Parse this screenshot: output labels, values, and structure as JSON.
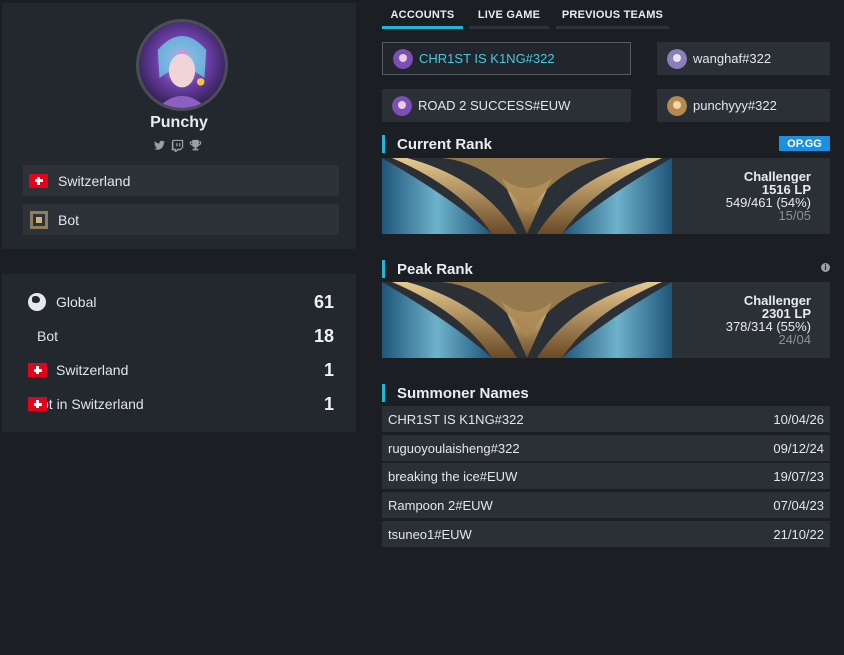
{
  "profile": {
    "name": "Punchy",
    "tags": [
      {
        "label": "Switzerland",
        "icon": "swiss-flag-icon"
      },
      {
        "label": "Bot",
        "icon": "bot-role-icon"
      }
    ],
    "social_icons": [
      "twitter-icon",
      "twitch-icon",
      "trophy-icon"
    ]
  },
  "ranking": [
    {
      "label": "Global",
      "value": "61",
      "icon": "globe-icon"
    },
    {
      "label": "Bot",
      "value": "18",
      "icon": ""
    },
    {
      "label": "Switzerland",
      "value": "1",
      "icon": "swiss-flag-icon"
    },
    {
      "label": "ot in Switzerland",
      "value": "1",
      "icon": "swiss-flag-icon"
    }
  ],
  "tabs": [
    {
      "label": "ACCOUNTS",
      "active": true
    },
    {
      "label": "LIVE GAME",
      "active": false
    },
    {
      "label": "PREVIOUS TEAMS",
      "active": false
    }
  ],
  "accounts": [
    {
      "name": "CHR1ST IS K1NG#322",
      "selected": true
    },
    {
      "name": "wanghaf#322",
      "selected": false
    },
    {
      "name": "ROAD 2 SUCCESS#EUW",
      "selected": false
    },
    {
      "name": "punchyyy#322",
      "selected": false
    }
  ],
  "current_rank": {
    "title": "Current Rank",
    "badge": "OP.GG",
    "tier": "Challenger",
    "lp": "1516 LP",
    "record": "549/461 (54%)",
    "date": "15/05"
  },
  "peak_rank": {
    "title": "Peak Rank",
    "tier": "Challenger",
    "lp": "2301 LP",
    "record": "378/314 (55%)",
    "date": "24/04"
  },
  "summoner_names": {
    "title": "Summoner Names",
    "rows": [
      {
        "name": "CHR1ST IS K1NG#322",
        "date": "10/04/26"
      },
      {
        "name": "ruguoyoulaisheng#322",
        "date": "09/12/24"
      },
      {
        "name": "breaking the ice#EUW",
        "date": "19/07/23"
      },
      {
        "name": "Rampoon 2#EUW",
        "date": "07/04/23"
      },
      {
        "name": "tsuneo1#EUW",
        "date": "21/10/22"
      }
    ]
  },
  "colors": {
    "accent": "#1fb6d8",
    "background": "#1b1e23",
    "card": "#23272e",
    "opgg": "#1c8fe0"
  }
}
